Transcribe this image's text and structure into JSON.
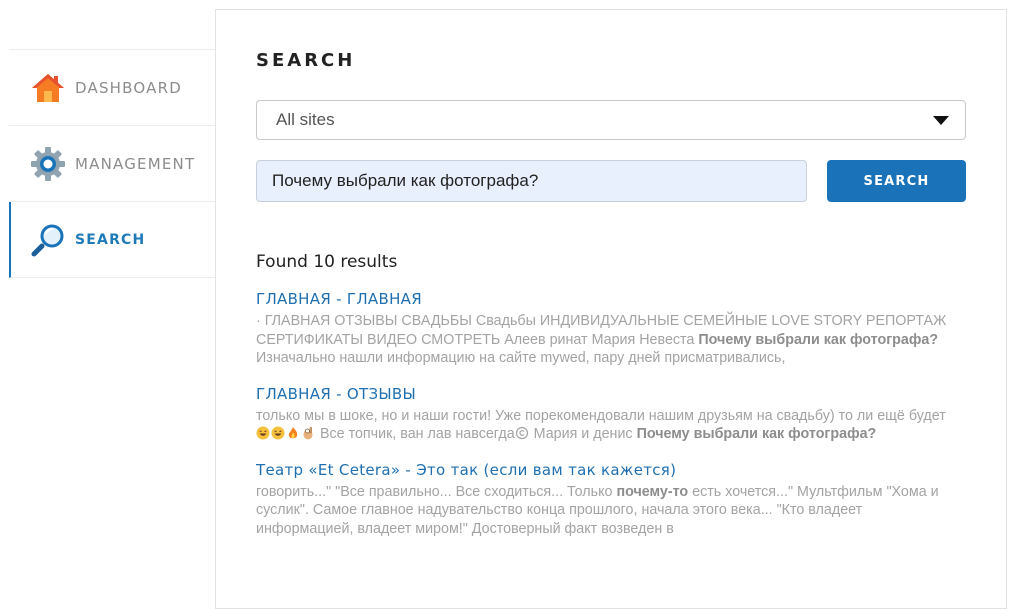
{
  "sidebar": {
    "items": [
      {
        "label": "DASHBOARD",
        "icon": "house-icon",
        "active": false
      },
      {
        "label": "MANAGEMENT",
        "icon": "gear-icon",
        "active": false
      },
      {
        "label": "SEARCH",
        "icon": "magnifier-icon",
        "active": true
      }
    ]
  },
  "search": {
    "title": "SEARCH",
    "site_select": "All sites",
    "query": "Почему выбрали как фотографа?",
    "button": "SEARCH",
    "found": "Found 10 results"
  },
  "results": [
    {
      "title": "ГЛАВНАЯ - ГЛАВНАЯ",
      "snippet_1": "· ГЛАВНАЯ ОТЗЫВЫ СВАДЬБЫ Свадьбы ИНДИВИДУАЛЬНЫЕ СЕМЕЙНЫЕ LOVE STORY РЕПОРТАЖ СЕРТИФИКАТЫ ВИДЕО СМОТРЕТЬ Алеев ринат Мария Невеста ",
      "highlight": "Почему выбрали как фотографа?",
      "snippet_2": " Изначально нашли информацию на сайте mywed, пару дней присматривались,"
    },
    {
      "title": "ГЛАВНАЯ - ОТЗЫВЫ",
      "snippet_1": "только мы в шоке, но и наши гости! Уже порекомендовали нашим друзьям на свадьбу) то ли ещё будет",
      "snippet_2": " Все топчик, ван лав навсегда",
      "snippet_3": " Мария и денис ",
      "highlight": "Почему выбрали как фотографа?"
    },
    {
      "title": "Театр «Et Cetera» - Это так (если вам так кажется)",
      "snippet_1": "говорить...\" \"Все правильно... Все сходиться... Только ",
      "highlight": "почему-то",
      "snippet_2": " есть хочется...\" Мультфильм \"Хома и суслик\". Самое главное надувательство конца прошлого, начала этого века... \"Кто владеет информацией, владеет миром!\" Достоверный факт возведен в"
    }
  ],
  "colors": {
    "accent": "#1a73b8",
    "link": "#1f6fb0",
    "snippet": "#a3a3a3",
    "input_bg": "#e8f0fe"
  }
}
